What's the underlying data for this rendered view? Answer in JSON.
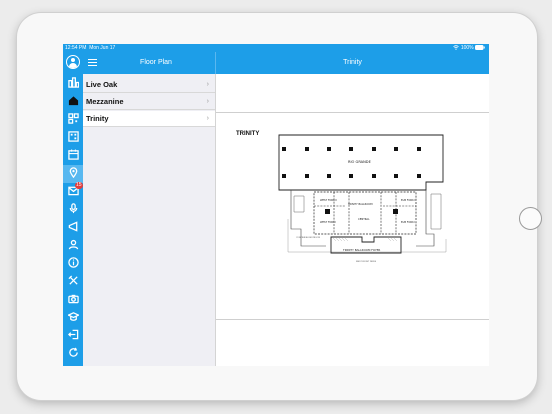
{
  "status_bar": {
    "time": "12:54 PM",
    "date": "Mon Jun 17",
    "battery": "100%"
  },
  "header": {
    "master_title": "Floor Plan",
    "detail_title": "Trinity"
  },
  "sidebar_rail": {
    "items": [
      {
        "icon": "sponsors-icon"
      },
      {
        "icon": "home-icon"
      },
      {
        "icon": "qr-code-icon"
      },
      {
        "icon": "qr-scan-icon"
      },
      {
        "icon": "calendar-icon"
      },
      {
        "icon": "location-pin-icon"
      },
      {
        "icon": "inbox-icon",
        "badge": "15"
      },
      {
        "icon": "microphone-icon"
      },
      {
        "icon": "megaphone-icon"
      },
      {
        "icon": "attendees-icon"
      },
      {
        "icon": "info-icon"
      },
      {
        "icon": "crossed-tools-icon"
      },
      {
        "icon": "camera-icon"
      },
      {
        "icon": "graduation-cap-icon"
      },
      {
        "icon": "logout-icon"
      },
      {
        "icon": "refresh-icon"
      }
    ],
    "active_index": 5
  },
  "floor_list": {
    "items": [
      {
        "label": "Live Oak",
        "selected": false
      },
      {
        "label": "Mezzanine",
        "selected": false
      },
      {
        "label": "Trinity",
        "selected": true
      }
    ]
  },
  "floor_plan": {
    "title": "TRINITY",
    "room_labels": {
      "rio_grande": "RIO GRANDE",
      "trinity_ballroom": "TRINITY BALLROOM",
      "west_fork_ii": "WEST FORK II",
      "west_fork_i": "WEST FORK I",
      "central": "CENTRAL",
      "elm_fork_ii": "ELM FORK II",
      "elm_fork_i": "ELM FORK I",
      "foyer": "TRINITY BALLROOM FOYER",
      "restroom": "CONCIERGE RESTROOM",
      "street": "WEST FRONT DRIVE"
    }
  }
}
